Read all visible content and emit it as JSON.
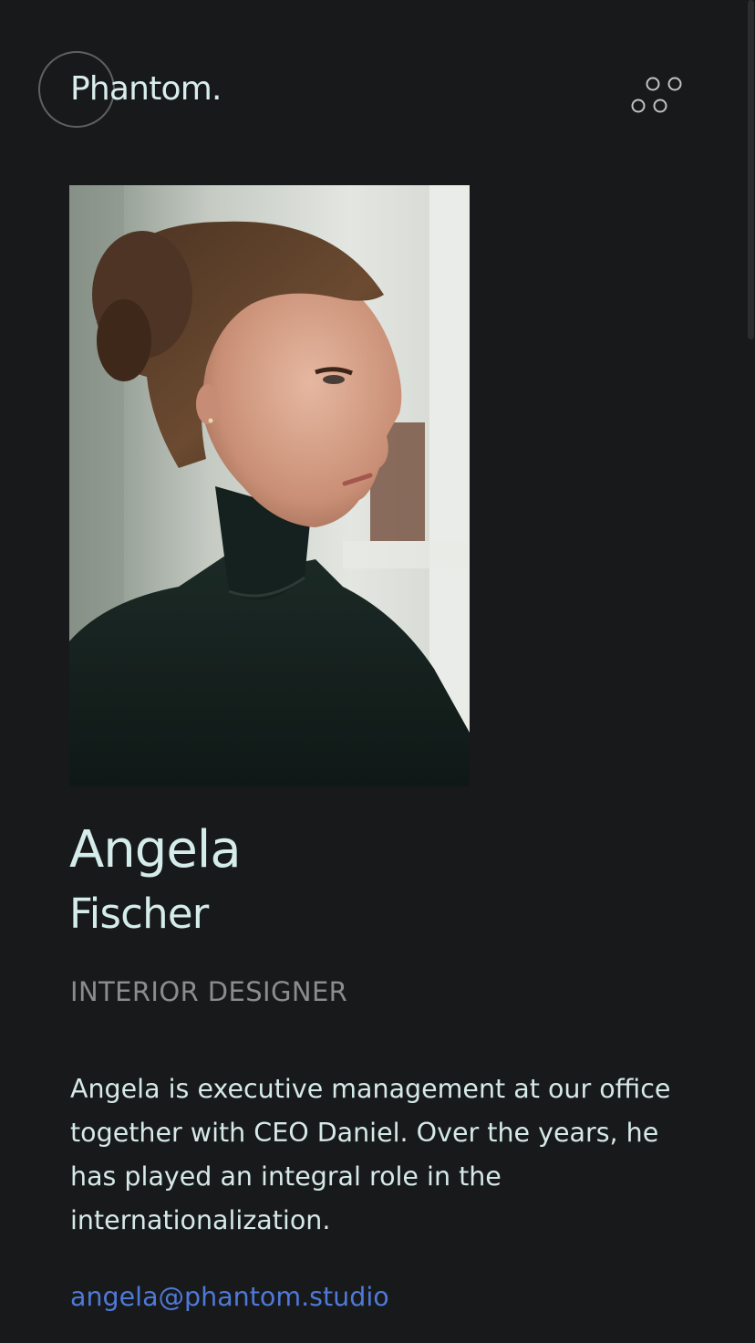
{
  "header": {
    "logo_text": "Phantom.",
    "menu_icon": "four-circles-menu-icon"
  },
  "profile": {
    "photo_alt": "Angela Fischer",
    "first_name": "Angela",
    "last_name": "Fischer",
    "role": "INTERIOR DESIGNER",
    "bio": "Angela is executive management at our office together with CEO Daniel. Over the years, he has played an integral role in the internationalization.",
    "email": "angela@phantom.studio"
  },
  "colors": {
    "background": "#18191a",
    "text": "#d4ecea",
    "muted": "#8a8c8d",
    "link": "#4f79d8"
  }
}
